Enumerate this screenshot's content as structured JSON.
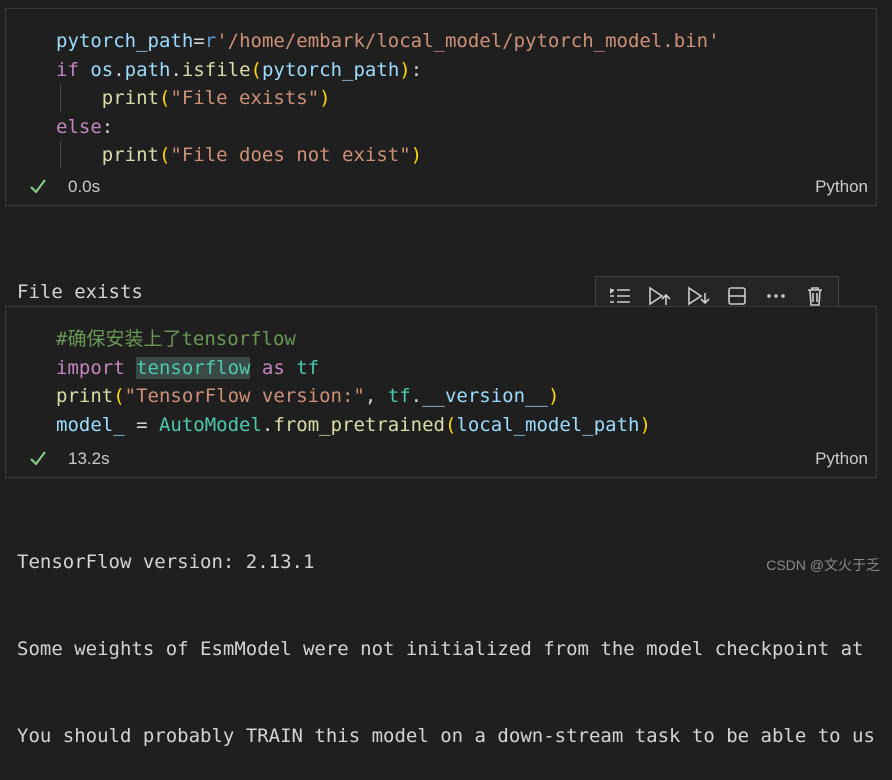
{
  "cell1": {
    "lines": [
      [
        {
          "t": "pytorch_path",
          "c": "var"
        },
        {
          "t": "=",
          "c": "plain"
        },
        {
          "t": "r",
          "c": "rprefix"
        },
        {
          "t": "'/home/embark/local_model/pytorch_model.bin'",
          "c": "str"
        }
      ],
      [
        {
          "t": "if ",
          "c": "kw"
        },
        {
          "t": "os",
          "c": "var"
        },
        {
          "t": ".",
          "c": "plain"
        },
        {
          "t": "path",
          "c": "var"
        },
        {
          "t": ".",
          "c": "plain"
        },
        {
          "t": "isfile",
          "c": "fn"
        },
        {
          "t": "(",
          "c": "paren1"
        },
        {
          "t": "pytorch_path",
          "c": "var"
        },
        {
          "t": ")",
          "c": "paren1"
        },
        {
          "t": ":",
          "c": "plain"
        }
      ],
      [
        {
          "t": "    ",
          "c": "plain"
        },
        {
          "t": "print",
          "c": "fn"
        },
        {
          "t": "(",
          "c": "paren1"
        },
        {
          "t": "\"File exists\"",
          "c": "str"
        },
        {
          "t": ")",
          "c": "paren1"
        }
      ],
      [
        {
          "t": "else",
          "c": "kw"
        },
        {
          "t": ":",
          "c": "plain"
        }
      ],
      [
        {
          "t": "    ",
          "c": "plain"
        },
        {
          "t": "print",
          "c": "fn"
        },
        {
          "t": "(",
          "c": "paren1"
        },
        {
          "t": "\"File does not exist\"",
          "c": "str"
        },
        {
          "t": ")",
          "c": "paren1"
        }
      ]
    ],
    "status_time": "0.0s",
    "language": "Python"
  },
  "output1": "File exists",
  "toolbar": {
    "icons": [
      "execute-above-icon",
      "run-by-line-icon",
      "execute-below-icon",
      "split-cell-icon",
      "more-icon",
      "delete-icon"
    ]
  },
  "cell2": {
    "lines": [
      [
        {
          "t": "#确保安装上了tensorflow",
          "c": "cmt"
        }
      ],
      [
        {
          "t": "import ",
          "c": "kw"
        },
        {
          "t": "tensorflow",
          "c": "cls hl"
        },
        {
          "t": " as ",
          "c": "kw"
        },
        {
          "t": "tf",
          "c": "cls"
        }
      ],
      [
        {
          "t": "print",
          "c": "fn"
        },
        {
          "t": "(",
          "c": "paren1"
        },
        {
          "t": "\"TensorFlow version:\"",
          "c": "str"
        },
        {
          "t": ", ",
          "c": "plain"
        },
        {
          "t": "tf",
          "c": "cls"
        },
        {
          "t": ".",
          "c": "plain"
        },
        {
          "t": "__version__",
          "c": "var"
        },
        {
          "t": ")",
          "c": "paren1"
        }
      ],
      [
        {
          "t": "model_",
          "c": "var"
        },
        {
          "t": " = ",
          "c": "plain"
        },
        {
          "t": "AutoModel",
          "c": "cls"
        },
        {
          "t": ".",
          "c": "plain"
        },
        {
          "t": "from_pretrained",
          "c": "fn"
        },
        {
          "t": "(",
          "c": "paren1"
        },
        {
          "t": "local_model_path",
          "c": "var"
        },
        {
          "t": ")",
          "c": "paren1"
        }
      ]
    ],
    "status_time": "13.2s",
    "language": "Python"
  },
  "output2": {
    "lines": [
      "TensorFlow version: 2.13.1",
      "Some weights of EsmModel were not initialized from the model checkpoint at",
      "You should probably TRAIN this model on a down-stream task to be able to us"
    ]
  },
  "watermark": "CSDN @文火于乏"
}
